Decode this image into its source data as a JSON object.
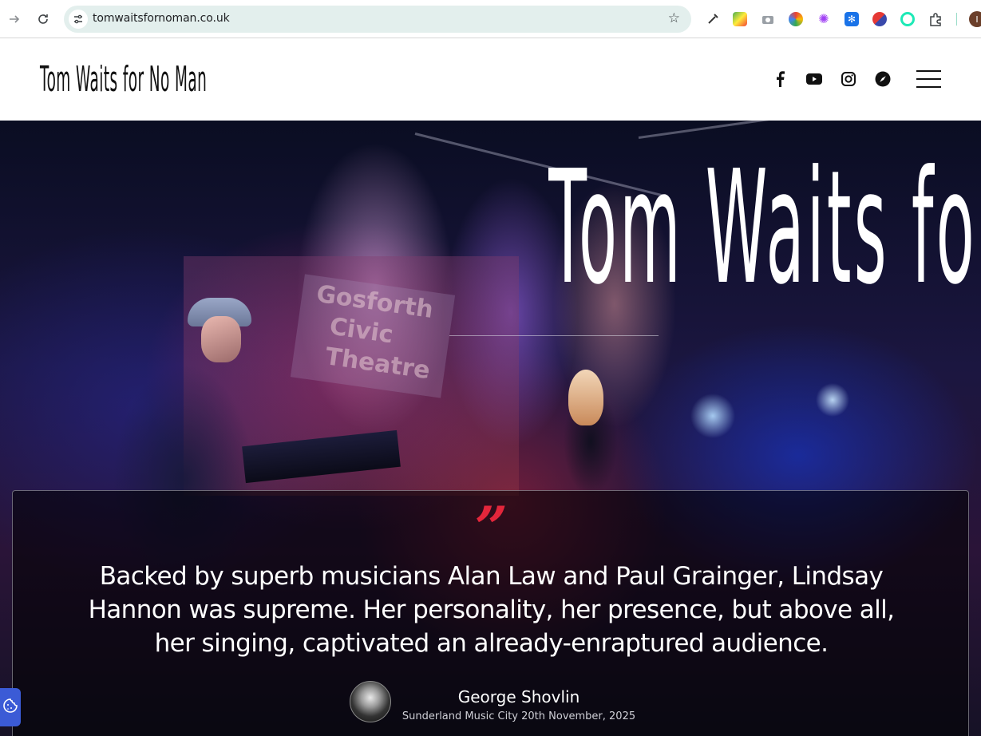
{
  "browser": {
    "url": "tomwaitsfornoman.co.uk",
    "back_icon": "arrow-right-icon",
    "reload_icon": "reload-icon",
    "profile_initial": "I"
  },
  "site": {
    "logo_text": "Tom Waits for No Man",
    "social": [
      "facebook-icon",
      "youtube-icon",
      "instagram-icon",
      "compass-icon"
    ],
    "menu_icon": "hamburger-menu-icon"
  },
  "hero": {
    "title": "Tom Waits for No Man",
    "sign_lines": [
      "Gosforth",
      "Civic",
      "Theatre"
    ]
  },
  "review": {
    "quote_mark": "”",
    "text": "Backed by superb musicians Alan Law and Paul Grainger, Lindsay Hannon was supreme. Her personality, her presence, but above all, her singing, captivated an already-enraptured audience.",
    "reviewer_name": "George Shovlin",
    "reviewer_source": "Sunderland Music City 20th November, 2025"
  },
  "colors": {
    "accent_red": "#e3263b",
    "omnibox_bg": "#e3efed",
    "cookie_blue": "#3b5bd6"
  }
}
